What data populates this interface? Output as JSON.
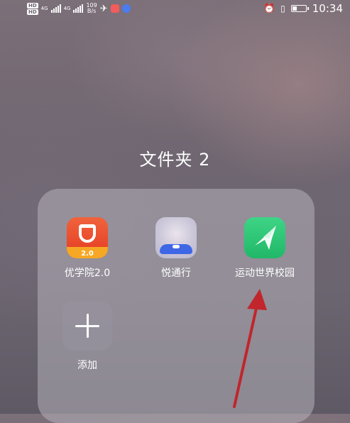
{
  "status_bar": {
    "hd1": "HD",
    "hd2": "HD",
    "net1": "4G",
    "net2": "4G",
    "speed_value": "109",
    "speed_unit": "B/s",
    "time": "10:34",
    "battery_level": 0.3,
    "icons": [
      "signal-icon",
      "airplane-icon",
      "alarm-icon",
      "vibrate-icon",
      "battery-icon"
    ]
  },
  "folder": {
    "title": "文件夹 2",
    "apps": [
      {
        "label": "优学院2.0",
        "icon": "youxueyuan-app-icon",
        "badge": "2.0"
      },
      {
        "label": "悦通行",
        "icon": "yuetongxing-app-icon"
      },
      {
        "label": "运动世界校园",
        "icon": "sport-world-app-icon"
      }
    ],
    "add_label": "添加"
  },
  "colors": {
    "annotation_arrow": "#c0262b",
    "sport_green": "#22b96a",
    "youxue_red": "#e84a2a",
    "yue_blue": "#3e67e6"
  }
}
